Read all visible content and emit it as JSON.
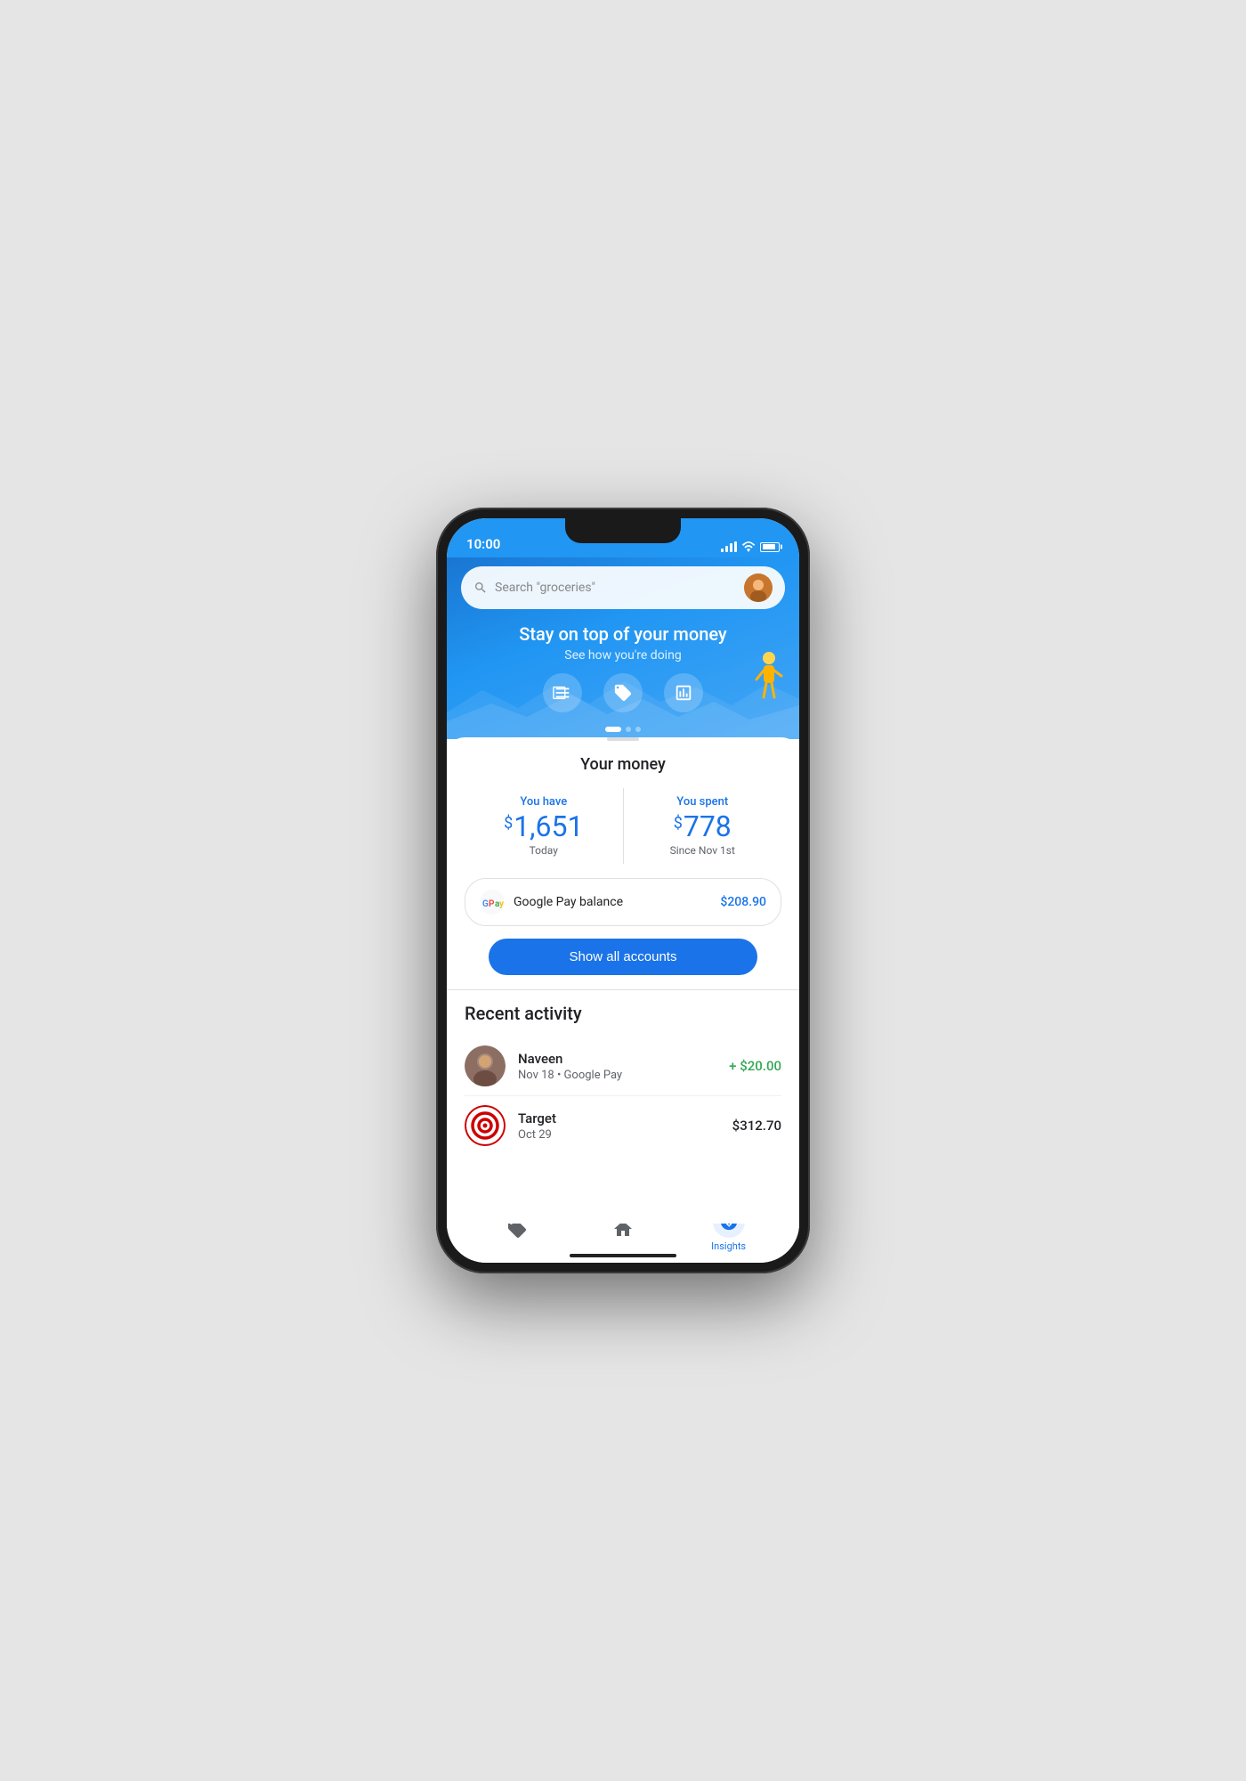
{
  "status_bar": {
    "time": "10:00"
  },
  "header": {
    "search_placeholder": "Search \"groceries\"",
    "hero_title": "Stay on top of your money",
    "hero_subtitle": "See how you're doing"
  },
  "action_buttons": [
    {
      "icon": "list-icon",
      "label": "Transactions"
    },
    {
      "icon": "tag-icon",
      "label": "Offers"
    },
    {
      "icon": "chart-icon",
      "label": "Insights"
    }
  ],
  "money_section": {
    "title": "Your money",
    "you_have_label": "You have",
    "you_have_dollar": "$",
    "you_have_amount": "1,651",
    "you_have_sublabel": "Today",
    "you_spent_label": "You spent",
    "you_spent_dollar": "$",
    "you_spent_amount": "778",
    "you_spent_sublabel": "Since Nov 1st",
    "gpay_balance_label": "Google Pay balance",
    "gpay_balance_amount": "$208.90",
    "show_all_button": "Show all accounts"
  },
  "recent_activity": {
    "title": "Recent activity",
    "items": [
      {
        "name": "Naveen",
        "meta": "Nov 18 • Google Pay",
        "amount": "+ $20.00",
        "amount_type": "positive",
        "avatar_type": "person"
      },
      {
        "name": "Target",
        "meta": "Oct 29",
        "amount": "$312.70",
        "amount_type": "neutral",
        "avatar_type": "target"
      }
    ]
  },
  "bottom_nav": {
    "items": [
      {
        "icon": "tag-nav-icon",
        "label": ""
      },
      {
        "icon": "home-icon",
        "label": ""
      },
      {
        "icon": "insights-icon",
        "label": "Insights",
        "active": true
      }
    ]
  }
}
